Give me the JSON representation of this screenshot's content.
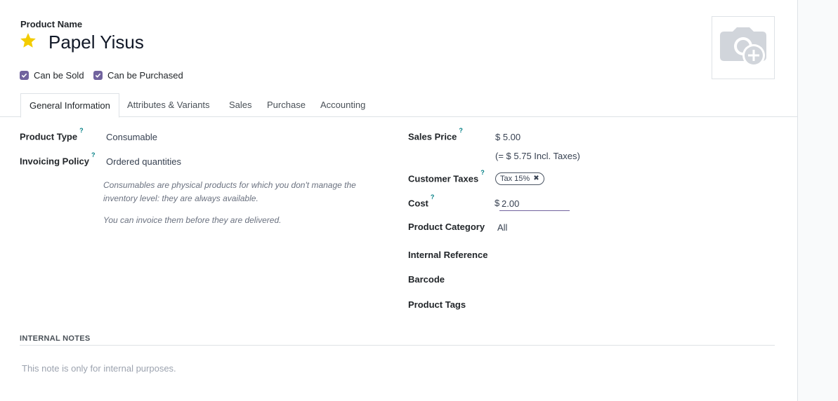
{
  "product": {
    "name_label": "Product Name",
    "name": "Papel Yisus",
    "can_be_sold_label": "Can be Sold",
    "can_be_purchased_label": "Can be Purchased",
    "can_be_sold": true,
    "can_be_purchased": true,
    "favorite": true
  },
  "tabs": [
    {
      "label": "General Information",
      "active": true
    },
    {
      "label": "Attributes & Variants"
    },
    {
      "label": "Sales"
    },
    {
      "label": "Purchase"
    },
    {
      "label": "Accounting"
    }
  ],
  "general": {
    "product_type_label": "Product Type",
    "product_type": "Consumable",
    "invoicing_policy_label": "Invoicing Policy",
    "invoicing_policy": "Ordered quantities",
    "help_mark": "?",
    "note1": "Consumables are physical products for which you don't manage the inventory level: they are always available.",
    "note2": "You can invoice them before they are delivered.",
    "sales_price_label": "Sales Price",
    "sales_price": "$ 5.00",
    "incl_taxes": "(= $ 5.75 Incl. Taxes)",
    "customer_taxes_label": "Customer Taxes",
    "tax_tag": "Tax 15%",
    "cost_label": "Cost",
    "cost_currency": "$",
    "cost_value": "2.00",
    "product_category_label": "Product Category",
    "product_category": "All",
    "internal_reference_label": "Internal Reference",
    "barcode_label": "Barcode",
    "product_tags_label": "Product Tags"
  },
  "notes": {
    "title": "INTERNAL NOTES",
    "placeholder": "This note is only for internal purposes."
  },
  "colors": {
    "accent": "#71639e",
    "star": "#f3cc00",
    "help": "#017e84"
  }
}
